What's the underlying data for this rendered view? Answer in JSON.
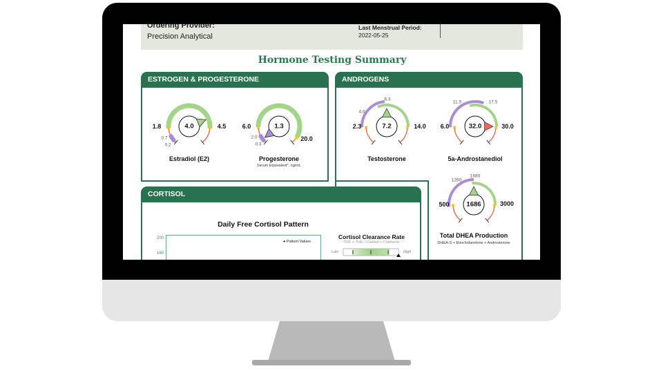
{
  "header": {
    "ordering_provider_label": "Ordering Provider:",
    "ordering_provider_value": "Precision Analytical",
    "lmp_label": "Last Menstrual Period:",
    "lmp_value": "2022-05-25"
  },
  "title": "Hormone Testing Summary",
  "panels": {
    "estrogen": "ESTROGEN & PROGESTERONE",
    "androgens": "ANDROGENS",
    "cortisol": "CORTISOL"
  },
  "gauges": [
    {
      "id": "estradiol",
      "name": "Estradiol (E2)",
      "value": "4.0",
      "low": "1.8",
      "high": "4.5",
      "extra": [
        "0.7",
        "0.2"
      ],
      "status": "in-range"
    },
    {
      "id": "progesterone",
      "name": "Progesterone",
      "subtitle": "Serum Equivalent*, ng/mL",
      "value": "1.3",
      "low": "6.0",
      "high": "20.0",
      "extra": [
        "2.0",
        "0.3"
      ],
      "status": "low"
    },
    {
      "id": "testosterone",
      "name": "Testosterone",
      "value": "7.2",
      "low": "2.3",
      "high": "14.0",
      "extra": [
        "4.0",
        "6.3"
      ],
      "status": "in-range"
    },
    {
      "id": "androstanediol",
      "name": "5a-Androstanediol",
      "value": "32.0",
      "low": "6.0",
      "high": "30.0",
      "extra": [
        "11.5",
        "17.5"
      ],
      "status": "high"
    },
    {
      "id": "dhea",
      "name": "Total DHEA Production",
      "subtitle": "DHEA-S + Etiocholanolone + Androsterone",
      "value": "1686",
      "low": "500",
      "high": "3000",
      "extra": [
        "1260",
        "1680"
      ],
      "status": "in-range"
    }
  ],
  "cortisol": {
    "chart_title": "Daily Free Cortisol Pattern",
    "y_ticks": [
      "200",
      "160"
    ],
    "legend": "Patient Values",
    "clearance_title": "Cortisol Clearance Rate",
    "clearance_formula": "THF + THE / Cortisol + Cortisone",
    "low_label": "Low",
    "high_label": "High"
  },
  "colors": {
    "green": "#2a7150",
    "arc_green": "#a3d48a",
    "purple": "#a98bd6",
    "red": "#ee6b5a",
    "star": "#f5c518"
  }
}
